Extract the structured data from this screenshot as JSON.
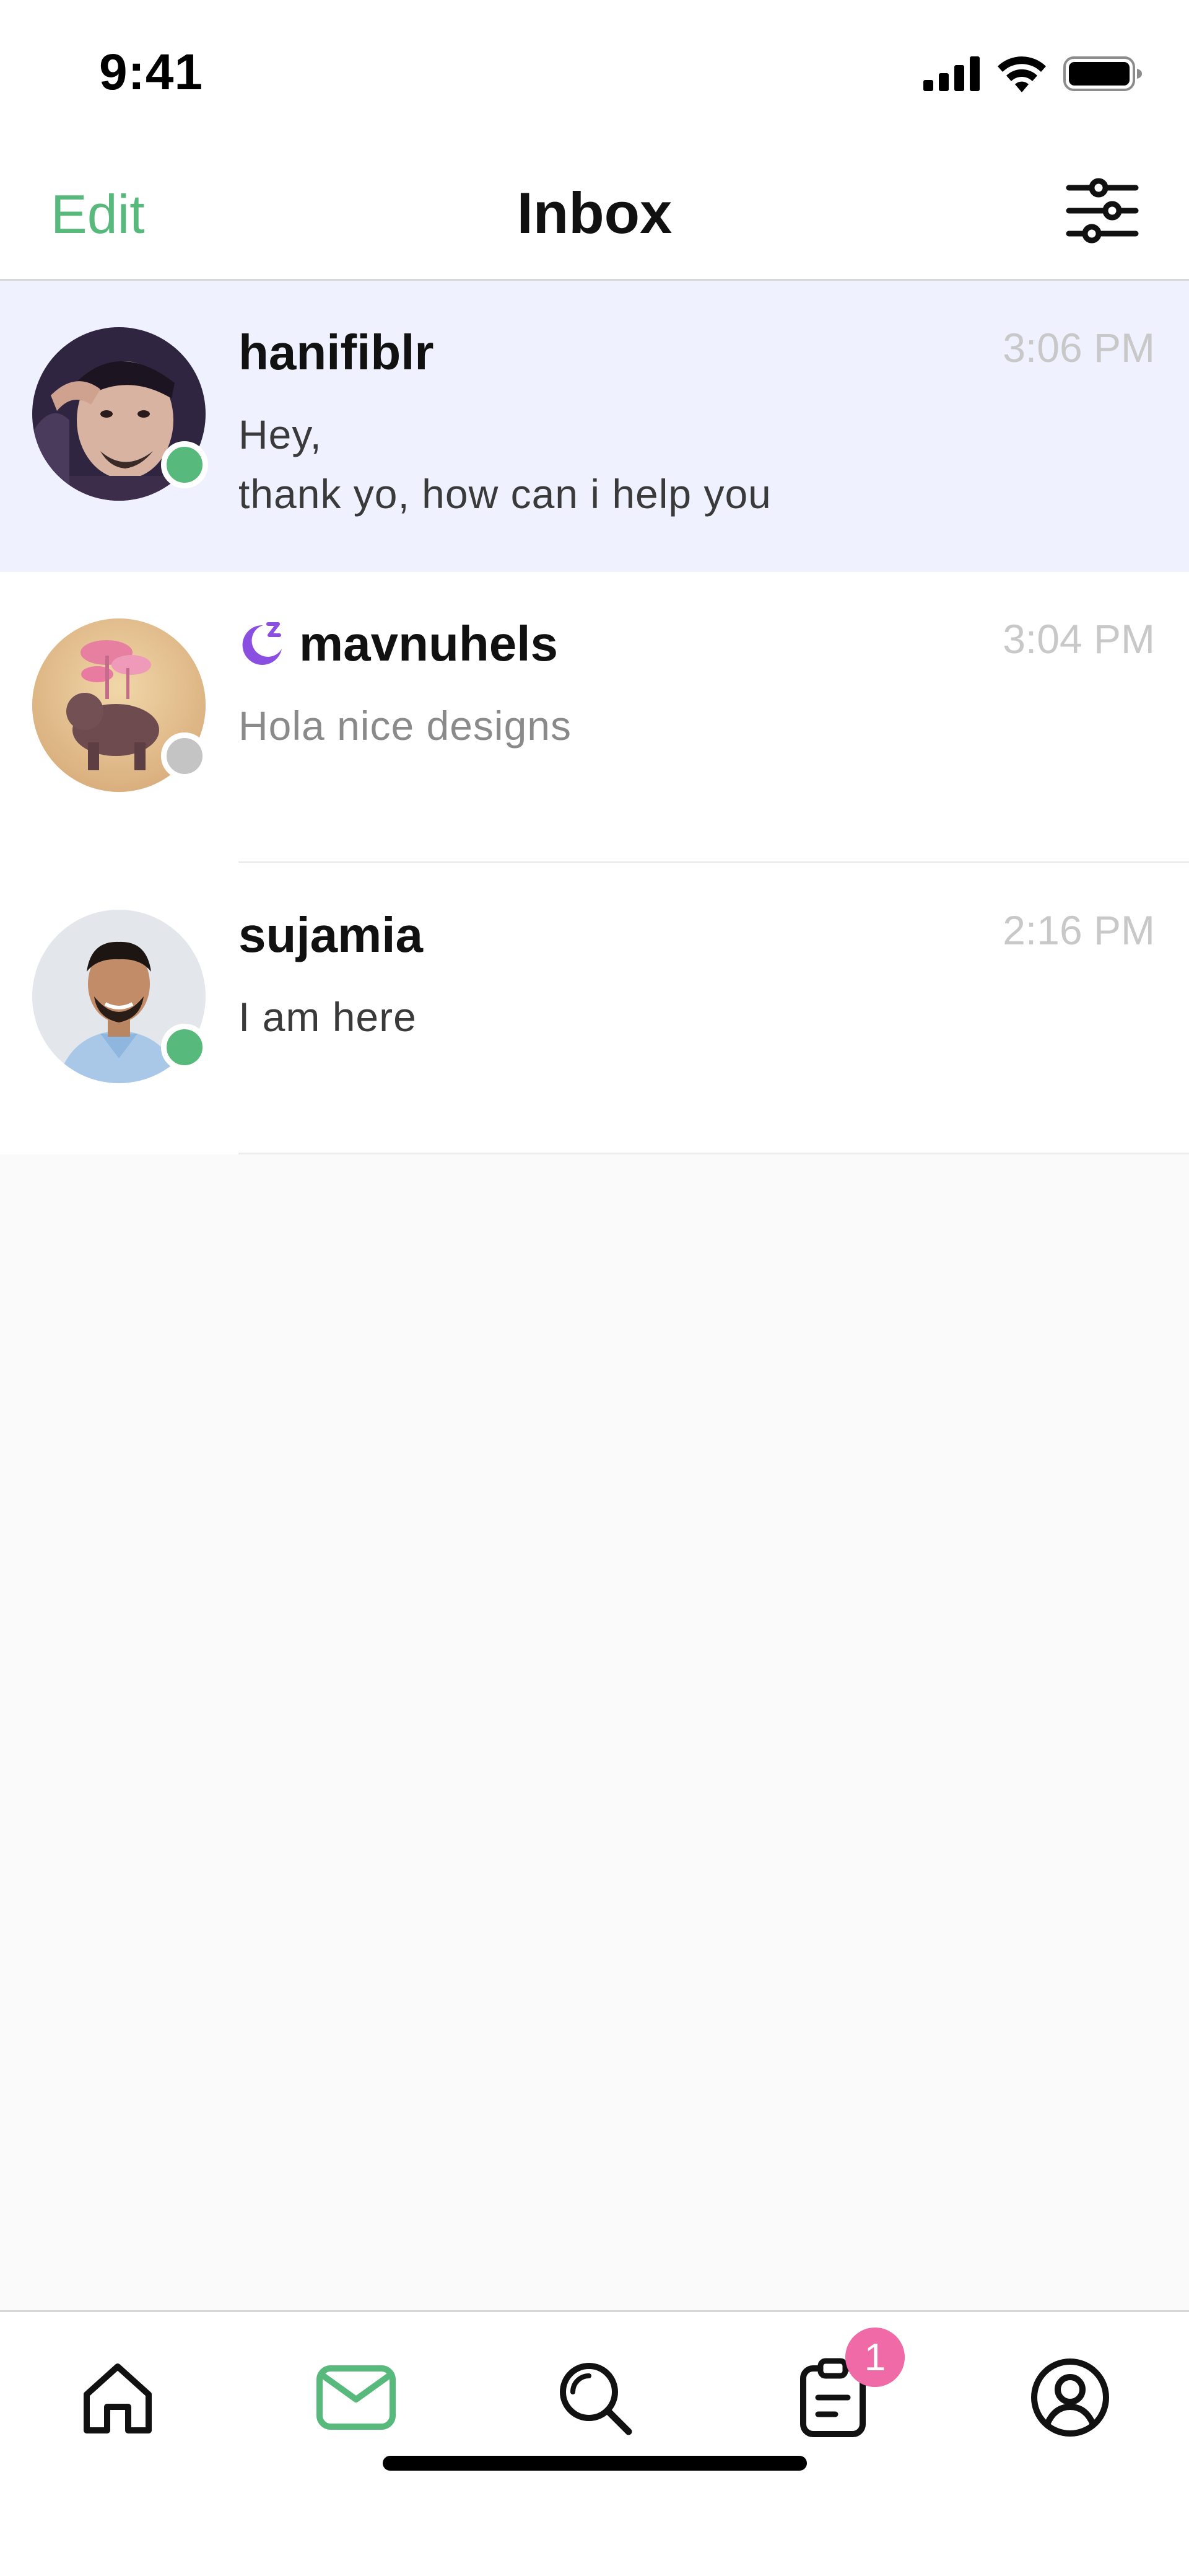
{
  "status_bar": {
    "time": "9:41",
    "icons": [
      "cellular-signal-icon",
      "wifi-icon",
      "battery-icon"
    ]
  },
  "nav": {
    "edit_label": "Edit",
    "title": "Inbox",
    "filter_icon": "sliders-icon"
  },
  "conversations": [
    {
      "name": "hanifiblr",
      "time": "3:06 PM",
      "message_line1": "Hey,",
      "message_line2": "thank yo, how can i help you",
      "online": true,
      "active": true
    },
    {
      "name": "mavnuhels",
      "time": "3:04 PM",
      "message_line1": "Hola nice designs",
      "online": false,
      "away_icon": "sleep-moon-icon"
    },
    {
      "name": "sujamia",
      "time": "2:16 PM",
      "message_line1": "I am here",
      "online": true
    }
  ],
  "tab_bar": {
    "tabs": [
      "home-icon",
      "inbox-icon",
      "search-icon",
      "orders-icon",
      "profile-icon"
    ],
    "active_tab": "inbox-icon",
    "orders_badge": "1"
  },
  "colors": {
    "accent_green": "#58b97c",
    "badge_pink": "#ef6aa6",
    "active_row": "#eff1fe",
    "offline_gray": "#c4c4c4",
    "away_purple": "#8a4fe0"
  }
}
